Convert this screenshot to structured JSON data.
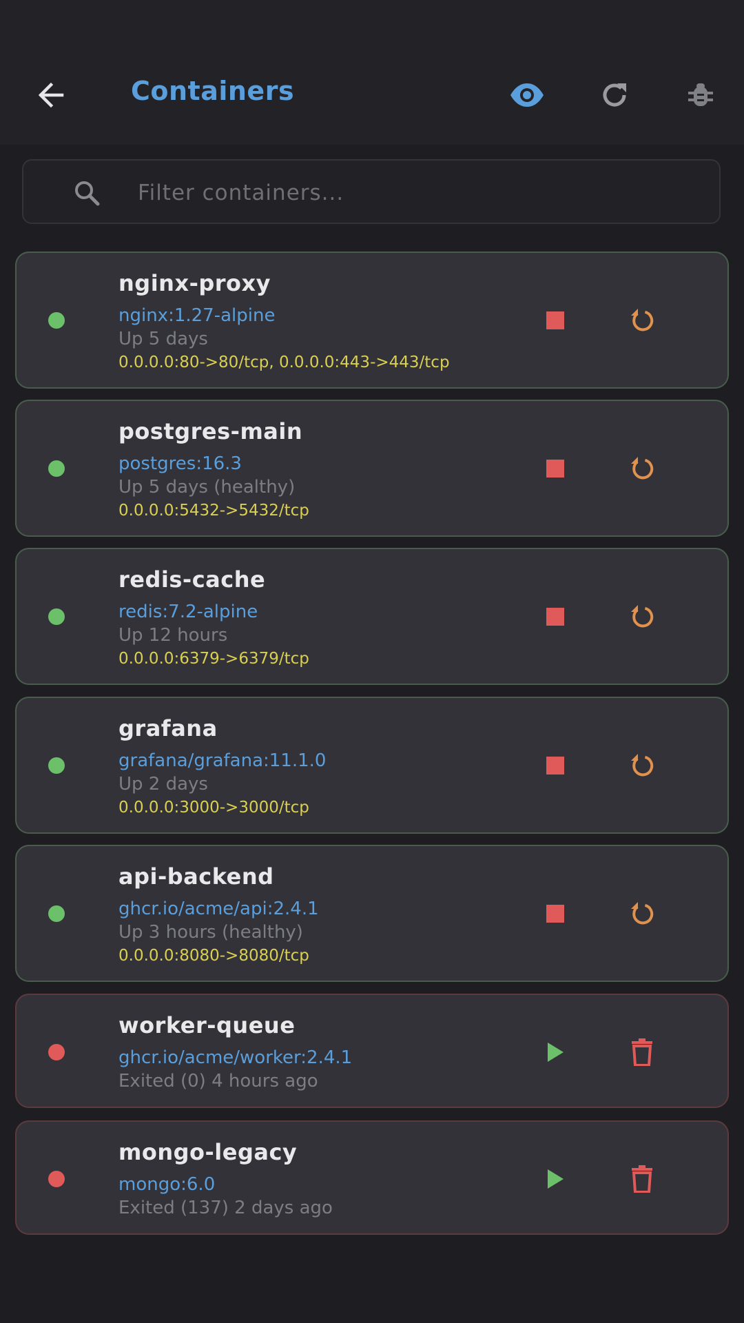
{
  "app": {
    "title": "Containers"
  },
  "search": {
    "placeholder": "Filter containers...",
    "value": ""
  },
  "colors": {
    "accent": "#5a9fdc",
    "running": "#6cc06a",
    "stopped": "#e05a5a",
    "ports": "#d9cf52",
    "restart": "#e0924e"
  },
  "icons": {
    "back": "arrow-left-icon",
    "view": "eye-icon",
    "refresh": "refresh-icon",
    "debug": "bug-icon",
    "stop": "stop-icon",
    "restart": "restart-icon",
    "start": "play-icon",
    "remove": "trash-icon"
  },
  "containers": [
    {
      "name": "nginx-proxy",
      "image": "nginx:1.27-alpine",
      "status": "Up 5 days",
      "ports": "0.0.0.0:80->80/tcp, 0.0.0.0:443->443/tcp",
      "state": "running"
    },
    {
      "name": "postgres-main",
      "image": "postgres:16.3",
      "status": "Up 5 days (healthy)",
      "ports": "0.0.0.0:5432->5432/tcp",
      "state": "running"
    },
    {
      "name": "redis-cache",
      "image": "redis:7.2-alpine",
      "status": "Up 12 hours",
      "ports": "0.0.0.0:6379->6379/tcp",
      "state": "running"
    },
    {
      "name": "grafana",
      "image": "grafana/grafana:11.1.0",
      "status": "Up 2 days",
      "ports": "0.0.0.0:3000->3000/tcp",
      "state": "running"
    },
    {
      "name": "api-backend",
      "image": "ghcr.io/acme/api:2.4.1",
      "status": "Up 3 hours (healthy)",
      "ports": "0.0.0.0:8080->8080/tcp",
      "state": "running"
    },
    {
      "name": "worker-queue",
      "image": "ghcr.io/acme/worker:2.4.1",
      "status": "Exited (0) 4 hours ago",
      "state": "exited"
    },
    {
      "name": "mongo-legacy",
      "image": "mongo:6.0",
      "status": "Exited (137) 2 days ago",
      "state": "exited"
    }
  ]
}
